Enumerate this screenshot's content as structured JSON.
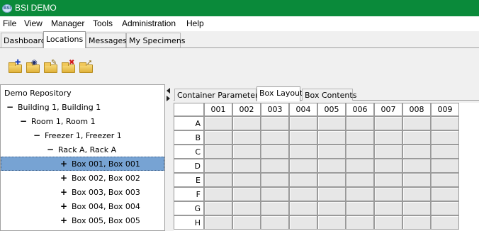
{
  "window": {
    "title": "BSI DEMO",
    "icon_text": "BSI"
  },
  "menu": [
    "File",
    "View",
    "Manager",
    "Tools",
    "Administration",
    "Help"
  ],
  "main_tabs": [
    "Dashboard",
    "Locations",
    "Messages",
    "My Specimens"
  ],
  "active_main_tab": "Locations",
  "toolbar": [
    {
      "icon": "folder-add-icon"
    },
    {
      "icon": "folder-view-icon"
    },
    {
      "icon": "folder-edit-icon"
    },
    {
      "icon": "folder-delete-icon"
    },
    {
      "icon": "folder-move-icon"
    }
  ],
  "tree": {
    "root": "Demo Repository",
    "items": [
      {
        "toggle": "−",
        "label": "Building 1, Building 1",
        "level": 1
      },
      {
        "toggle": "−",
        "label": "Room 1, Room 1",
        "level": 2
      },
      {
        "toggle": "−",
        "label": "Freezer 1, Freezer 1",
        "level": 3
      },
      {
        "toggle": "−",
        "label": "Rack A, Rack A",
        "level": 4
      },
      {
        "toggle": "+",
        "label": "Box 001, Box 001",
        "level": 5,
        "selected": true
      },
      {
        "toggle": "+",
        "label": "Box 002, Box 002",
        "level": 5
      },
      {
        "toggle": "+",
        "label": "Box 003, Box 003",
        "level": 5
      },
      {
        "toggle": "+",
        "label": "Box 004, Box 004",
        "level": 5
      },
      {
        "toggle": "+",
        "label": "Box 005, Box 005",
        "level": 5
      }
    ]
  },
  "detail_tabs": [
    "Container Parameters",
    "Box Layout",
    "Box Contents"
  ],
  "active_detail_tab": "Box Layout",
  "box_layout": {
    "columns": [
      "001",
      "002",
      "003",
      "004",
      "005",
      "006",
      "007",
      "008",
      "009"
    ],
    "rows": [
      "A",
      "B",
      "C",
      "D",
      "E",
      "F",
      "G",
      "H"
    ]
  },
  "colors": {
    "title_bar": "#0a8a3a",
    "selection": "#77a3d3",
    "cell": "#e7e7e7"
  }
}
